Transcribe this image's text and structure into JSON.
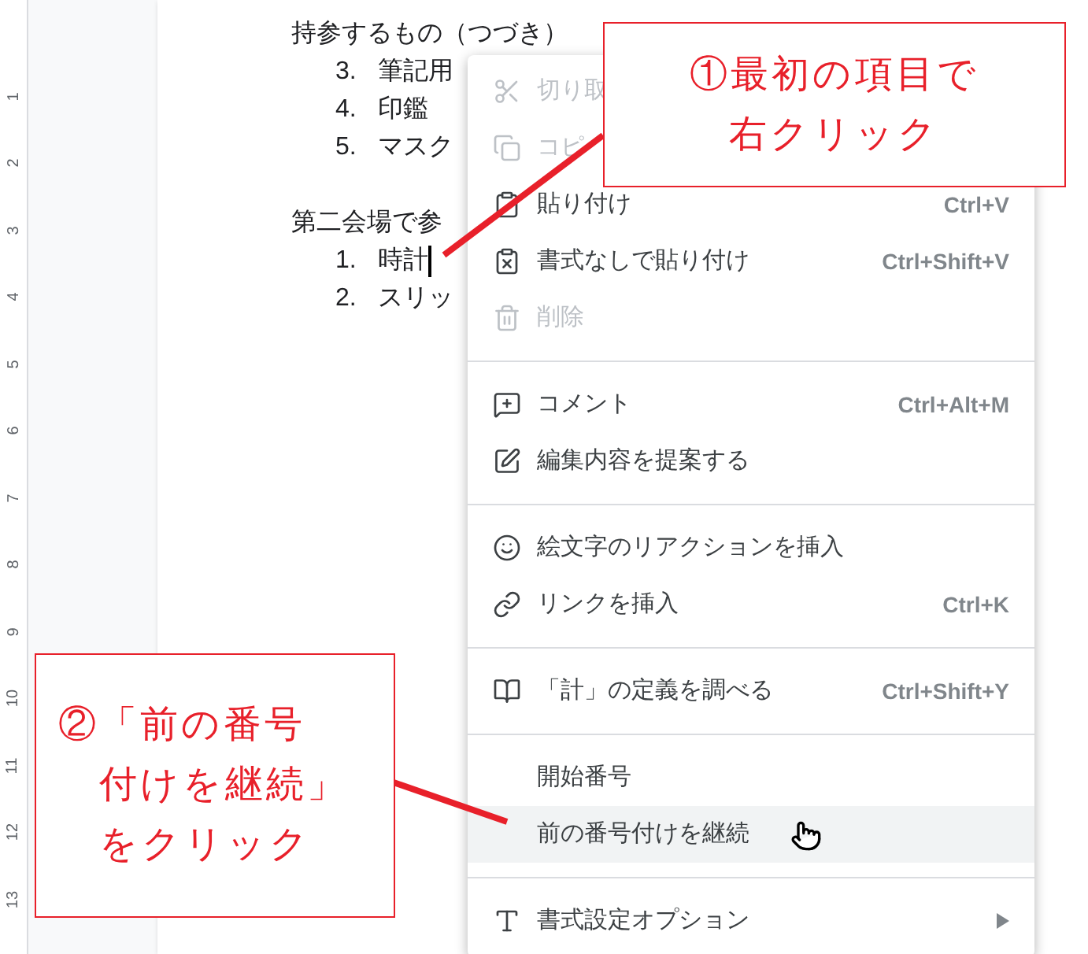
{
  "ruler": {
    "marks": [
      "1",
      "2",
      "3",
      "4",
      "5",
      "6",
      "7",
      "8",
      "9",
      "10",
      "11",
      "12",
      "13"
    ]
  },
  "document": {
    "sections": [
      {
        "heading": "持参するもの（つづき）",
        "items": [
          {
            "number": "3.",
            "text": "筆記用",
            "caret": false
          },
          {
            "number": "4.",
            "text": "印鑑",
            "caret": false
          },
          {
            "number": "5.",
            "text": "マスク",
            "caret": false
          }
        ]
      },
      {
        "heading": "第二会場で参",
        "items": [
          {
            "number": "1.",
            "text": "時計",
            "caret": true
          },
          {
            "number": "2.",
            "text": "スリッ",
            "caret": false
          }
        ]
      }
    ]
  },
  "context_menu": {
    "items": [
      {
        "kind": "item",
        "label": "切り取",
        "disabled": true,
        "selected": false,
        "submenu": false
      },
      {
        "kind": "item",
        "label": "コピ",
        "disabled": true,
        "selected": false,
        "submenu": false
      },
      {
        "kind": "item",
        "label": "貼り付け",
        "shortcut": "Ctrl+V",
        "disabled": false,
        "selected": false,
        "submenu": false
      },
      {
        "kind": "item",
        "label": "書式なしで貼り付け",
        "shortcut": "Ctrl+Shift+V",
        "disabled": false,
        "selected": false,
        "submenu": false
      },
      {
        "kind": "item",
        "label": "削除",
        "disabled": true,
        "selected": false,
        "submenu": false
      },
      {
        "kind": "divider"
      },
      {
        "kind": "item",
        "label": "コメント",
        "shortcut": "Ctrl+Alt+M",
        "disabled": false,
        "selected": false,
        "submenu": false
      },
      {
        "kind": "item",
        "label": "編集内容を提案する",
        "disabled": false,
        "selected": false,
        "submenu": false
      },
      {
        "kind": "divider"
      },
      {
        "kind": "item",
        "label": "絵文字のリアクションを挿入",
        "disabled": false,
        "selected": false,
        "submenu": false
      },
      {
        "kind": "item",
        "label": "リンクを挿入",
        "shortcut": "Ctrl+K",
        "disabled": false,
        "selected": false,
        "submenu": false
      },
      {
        "kind": "divider"
      },
      {
        "kind": "item",
        "label": "「計」の定義を調べる",
        "shortcut": "Ctrl+Shift+Y",
        "disabled": false,
        "selected": false,
        "submenu": false
      },
      {
        "kind": "divider"
      },
      {
        "kind": "item",
        "label": "開始番号",
        "disabled": false,
        "selected": false,
        "submenu": false
      },
      {
        "kind": "item",
        "label": "前の番号付けを継続",
        "disabled": false,
        "selected": true,
        "submenu": false
      },
      {
        "kind": "divider"
      },
      {
        "kind": "item",
        "label": "書式設定オプション",
        "disabled": false,
        "selected": false,
        "submenu": true
      }
    ]
  },
  "callouts": [
    {
      "lines": [
        "①最初の項目で",
        "右クリック"
      ]
    },
    {
      "lines": [
        "②「前の番号",
        "付けを継続」",
        "をクリック"
      ]
    }
  ]
}
